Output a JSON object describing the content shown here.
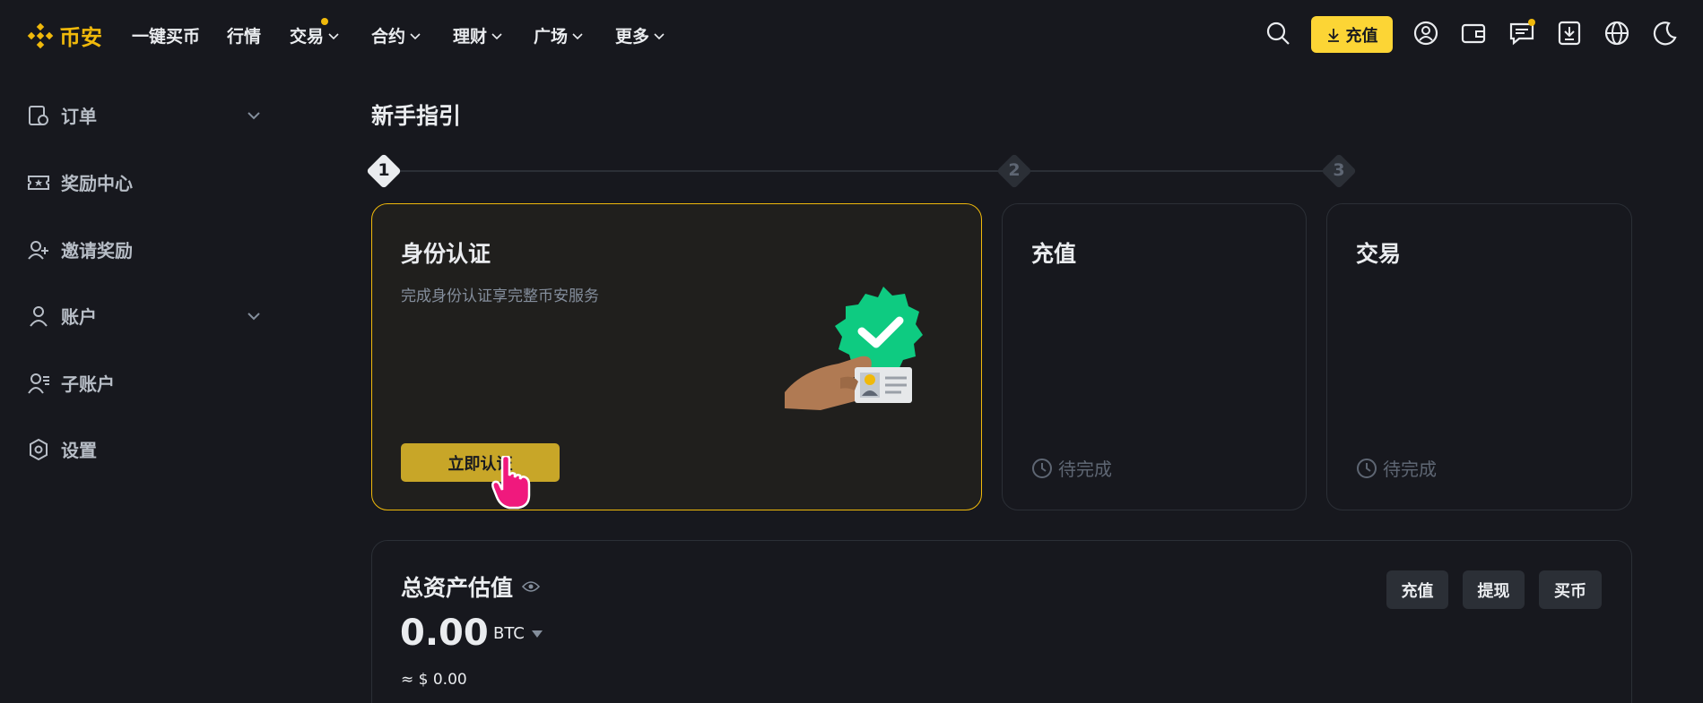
{
  "brand": {
    "name": "币安",
    "accent": "#f0b90b"
  },
  "nav": {
    "items": [
      {
        "label": "一键买币"
      },
      {
        "label": "行情"
      },
      {
        "label": "交易"
      },
      {
        "label": "合约"
      },
      {
        "label": "理财"
      },
      {
        "label": "广场"
      },
      {
        "label": "更多"
      }
    ],
    "deposit_label": "充值",
    "icons": [
      "search-icon",
      "download-icon",
      "user-icon",
      "wallet-icon",
      "message-icon",
      "app-download-icon",
      "globe-icon",
      "moon-icon"
    ]
  },
  "sidebar": {
    "items": [
      {
        "label": "订单",
        "icon": "order-icon"
      },
      {
        "label": "奖励中心",
        "icon": "ticket-icon"
      },
      {
        "label": "邀请奖励",
        "icon": "user-add-icon"
      },
      {
        "label": "账户",
        "icon": "user-icon"
      },
      {
        "label": "子账户",
        "icon": "sub-account-icon"
      },
      {
        "label": "设置",
        "icon": "settings-icon"
      }
    ]
  },
  "guide": {
    "title": "新手指引",
    "steps": [
      {
        "num": "1"
      },
      {
        "num": "2"
      },
      {
        "num": "3"
      }
    ],
    "cards": [
      {
        "title": "身份认证",
        "desc": "完成身份认证享完整币安服务",
        "button": "立即认证"
      },
      {
        "title": "充值",
        "status": "待完成"
      },
      {
        "title": "交易",
        "status": "待完成"
      }
    ]
  },
  "assets": {
    "title": "总资产估值",
    "value": "0.00",
    "unit": "BTC",
    "usd": "≈ $ 0.00",
    "buttons": [
      {
        "label": "充值"
      },
      {
        "label": "提现"
      },
      {
        "label": "买币"
      }
    ]
  }
}
